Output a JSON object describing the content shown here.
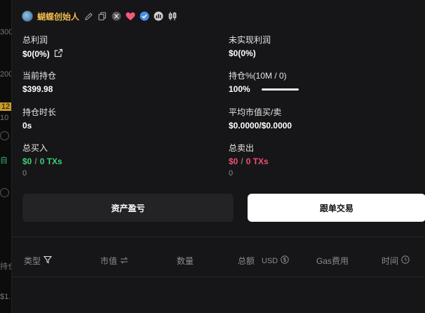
{
  "wallet": {
    "name": "蝴蝶创始人"
  },
  "stats": {
    "total_pnl": {
      "label": "总利润",
      "value": "$0(0%)"
    },
    "unrealized_pnl": {
      "label": "未实现利润",
      "value": "$0(0%)"
    },
    "current_holding": {
      "label": "当前持仓",
      "value": "$399.98"
    },
    "holding_pct": {
      "label": "持仓%(10M / 0)",
      "value": "100%",
      "fill": 1.0
    },
    "holding_time": {
      "label": "持仓时长",
      "value": "0s"
    },
    "avg_mcap": {
      "label": "平均市值买/卖",
      "value": "$0.0000/$0.0000"
    },
    "total_buy": {
      "label": "总买入",
      "amount": "$0",
      "separator": "/",
      "txs": "0 TXs",
      "count": "0"
    },
    "total_sell": {
      "label": "总卖出",
      "amount": "$0",
      "separator": "/",
      "txs": "0 TXs",
      "count": "0"
    }
  },
  "buttons": {
    "asset_pnl": "资产盈亏",
    "copy_trade": "跟单交易"
  },
  "table": {
    "columns": {
      "type": "类型",
      "mcap": "市值",
      "qty": "数量",
      "total": "总额",
      "currency": "USD",
      "gas": "Gas费用",
      "time": "时间"
    }
  },
  "background_fragments": {
    "f1": "300",
    "f2": "200",
    "f3": "12",
    "f4": "10",
    "f5": "自",
    "f6": "持仓",
    "f7": "$1."
  },
  "colors": {
    "accent_gold": "#f0b94a",
    "buy_green": "#3fcf74",
    "sell_red": "#f0506e"
  },
  "icons": [
    "edit-icon",
    "copy-icon",
    "x-twitter-icon",
    "heart-icon",
    "verified-icon",
    "chart-icon",
    "candles-icon",
    "external-link-icon",
    "filter-icon",
    "swap-icon",
    "usd-icon",
    "clock-icon"
  ]
}
